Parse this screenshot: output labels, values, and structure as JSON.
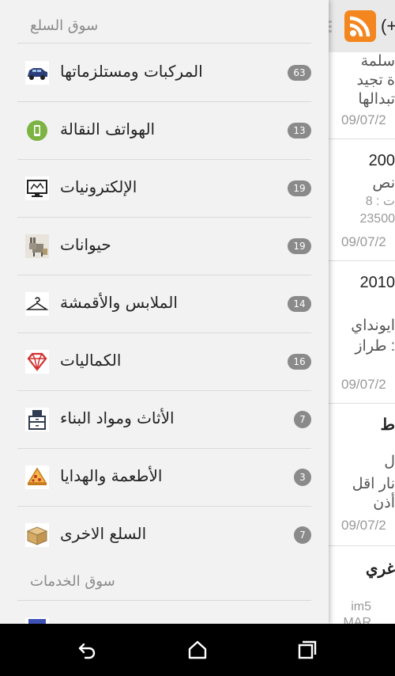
{
  "drawer": {
    "goods_header": "سوق السلع",
    "services_header": "سوق الخدمات",
    "categories": [
      {
        "label": "المركبات ومستلزماتها",
        "count": "63",
        "icon": "car-icon"
      },
      {
        "label": "الهواتف النقالة",
        "count": "13",
        "icon": "mobile-phone-icon"
      },
      {
        "label": "الإلكترونيات",
        "count": "19",
        "icon": "monitor-icon"
      },
      {
        "label": "حيوانات",
        "count": "19",
        "icon": "donkey-icon"
      },
      {
        "label": "الملابس والأقمشة",
        "count": "14",
        "icon": "clothes-hanger-icon"
      },
      {
        "label": "الكماليات",
        "count": "16",
        "icon": "diamond-icon"
      },
      {
        "label": "الأثاث ومواد البناء",
        "count": "7",
        "icon": "furniture-icon"
      },
      {
        "label": "الأطعمة والهدايا",
        "count": "3",
        "icon": "pizza-icon"
      },
      {
        "label": "السلع الاخرى",
        "count": "7",
        "icon": "box-icon"
      }
    ]
  },
  "content": {
    "app_label": "(+",
    "rss_icon": "rss-feed-icon",
    "cards": [
      {
        "lines": [
          "سلمة",
          "ة تجيد",
          "تبدالها"
        ],
        "date": "09/07/2"
      },
      {
        "lines": [
          "200",
          "نص",
          "ت : 8",
          "23500"
        ],
        "date": "09/07/2"
      },
      {
        "lines": [
          "2010",
          "ايونداي",
          "طراز :"
        ],
        "date": "09/07/2"
      },
      {
        "lines": [
          "ط",
          "ل",
          "نار اقل",
          "أذن"
        ],
        "date": "09/07/2"
      },
      {
        "lines": [
          "غري",
          "im5",
          "MAR"
        ],
        "date": ""
      }
    ]
  },
  "navbar": {
    "back_icon": "back-icon",
    "home_icon": "home-icon",
    "recents_icon": "recents-icon"
  },
  "colors": {
    "accent": "#f3861e",
    "badge": "#8a8a8a",
    "drawer_bg": "#f2f2f2"
  }
}
